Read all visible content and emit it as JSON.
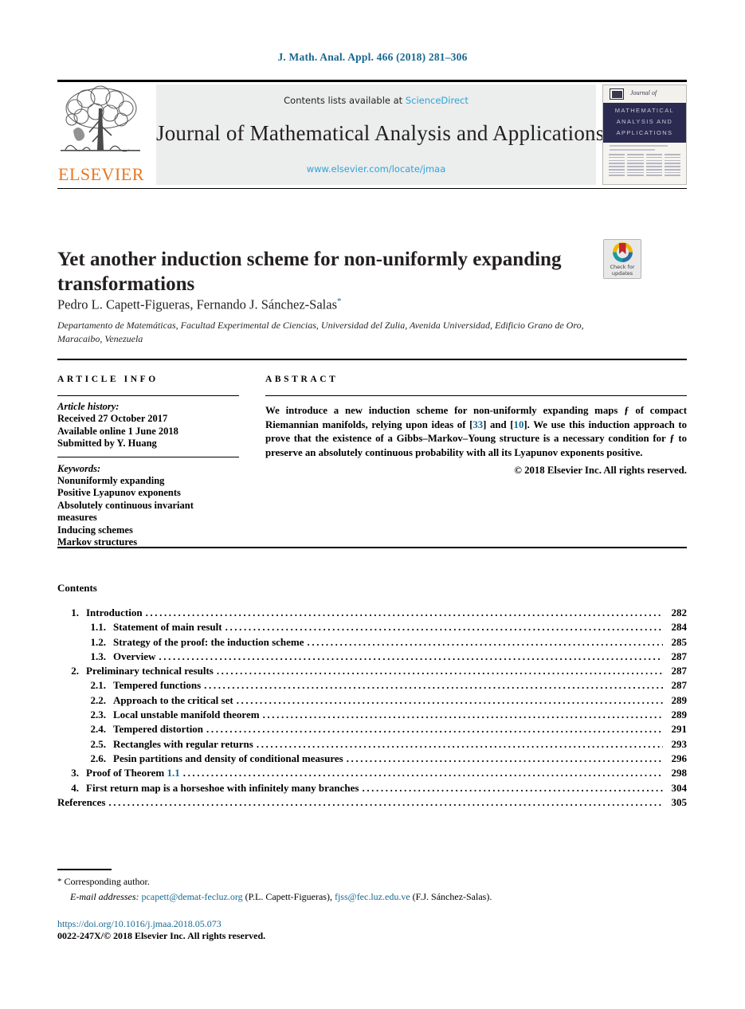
{
  "running_head": "J. Math. Anal. Appl. 466 (2018) 281–306",
  "masthead": {
    "contents_prefix": "Contents lists available at ",
    "sciencedirect": "ScienceDirect",
    "journal_name": "Journal of Mathematical Analysis and Applications",
    "journal_url": "www.elsevier.com/locate/jmaa",
    "publisher_logo_text": "ELSEVIER",
    "cover": {
      "journal_of": "Journal of",
      "line1": "MATHEMATICAL",
      "line2": "ANALYSIS AND",
      "line3": "APPLICATIONS"
    }
  },
  "article": {
    "title": "Yet another induction scheme for non-uniformly expanding transformations",
    "authors": "Pedro L. Capett-Figueras, Fernando J. Sánchez-Salas",
    "author_star": "*",
    "affiliation": "Departamento de Matemáticas, Facultad Experimental de Ciencias, Universidad del Zulia, Avenida Universidad, Edificio Grano de Oro, Maracaibo, Venezuela"
  },
  "badge": {
    "line1": "Check for",
    "line2": "updates"
  },
  "info": {
    "heading": "ARTICLE INFO",
    "history_heading": "Article history:",
    "history": [
      "Received 27 October 2017",
      "Available online 1 June 2018",
      "Submitted by Y. Huang"
    ],
    "keywords_heading": "Keywords:",
    "keywords": [
      "Nonuniformly expanding",
      "Positive Lyapunov exponents",
      "Absolutely continuous invariant",
      "measures",
      "Inducing schemes",
      "Markov structures"
    ]
  },
  "abstract": {
    "heading": "ABSTRACT",
    "p1a": "We introduce a new induction scheme for non-uniformly expanding maps ƒ of compact Riemannian manifolds, relying upon ideas of [",
    "ref1": "33",
    "p1b": "] and [",
    "ref2": "10",
    "p1c": "]. We use this induction approach to prove that the existence of a Gibbs–Markov–Young structure is a necessary condition for ƒ to preserve an absolutely continuous probability with all its Lyapunov exponents positive.",
    "copyright": "© 2018 Elsevier Inc. All rights reserved."
  },
  "contents": {
    "heading": "Contents",
    "rows": [
      {
        "num": "1.",
        "level": 1,
        "label": "Introduction",
        "page": "282"
      },
      {
        "num": "1.1.",
        "level": 2,
        "label": "Statement of main result",
        "page": "284"
      },
      {
        "num": "1.2.",
        "level": 2,
        "label": "Strategy of the proof: the induction scheme",
        "page": "285"
      },
      {
        "num": "1.3.",
        "level": 2,
        "label": "Overview",
        "page": "287"
      },
      {
        "num": "2.",
        "level": 1,
        "label": "Preliminary technical results",
        "page": "287"
      },
      {
        "num": "2.1.",
        "level": 2,
        "label": "Tempered functions",
        "page": "287"
      },
      {
        "num": "2.2.",
        "level": 2,
        "label": "Approach to the critical set",
        "page": "289"
      },
      {
        "num": "2.3.",
        "level": 2,
        "label": "Local unstable manifold theorem",
        "page": "289"
      },
      {
        "num": "2.4.",
        "level": 2,
        "label": "Tempered distortion",
        "page": "291"
      },
      {
        "num": "2.5.",
        "level": 2,
        "label": "Rectangles with regular returns",
        "page": "293"
      },
      {
        "num": "2.6.",
        "level": 2,
        "label": "Pesin partitions and density of conditional measures",
        "page": "296"
      },
      {
        "num": "3.",
        "level": 1,
        "label": "Proof of Theorem ",
        "link": "1.1",
        "page": "298"
      },
      {
        "num": "4.",
        "level": 1,
        "label": "First return map is a horseshoe with infinitely many branches",
        "page": "304"
      },
      {
        "num": "",
        "level": 0,
        "label": "References",
        "page": "305"
      }
    ]
  },
  "footnotes": {
    "corresponding_star": "*",
    "corresponding": "Corresponding author.",
    "email_label": "E-mail addresses:",
    "email1": "pcapett@demat-fecluz.org",
    "email1_owner": "(P.L. Capett-Figueras),",
    "email2": "fjss@fec.luz.edu.ve",
    "email2_owner": "(F.J. Sánchez-Salas).",
    "doi": "https://doi.org/10.1016/j.jmaa.2018.05.073",
    "issn": "0022-247X/© 2018 Elsevier Inc. All rights reserved."
  },
  "colors": {
    "link": "#17688f",
    "sciencedirect": "#2ca4d8",
    "elsevier_orange": "#e87722",
    "cover_band": "#2b2a50"
  }
}
